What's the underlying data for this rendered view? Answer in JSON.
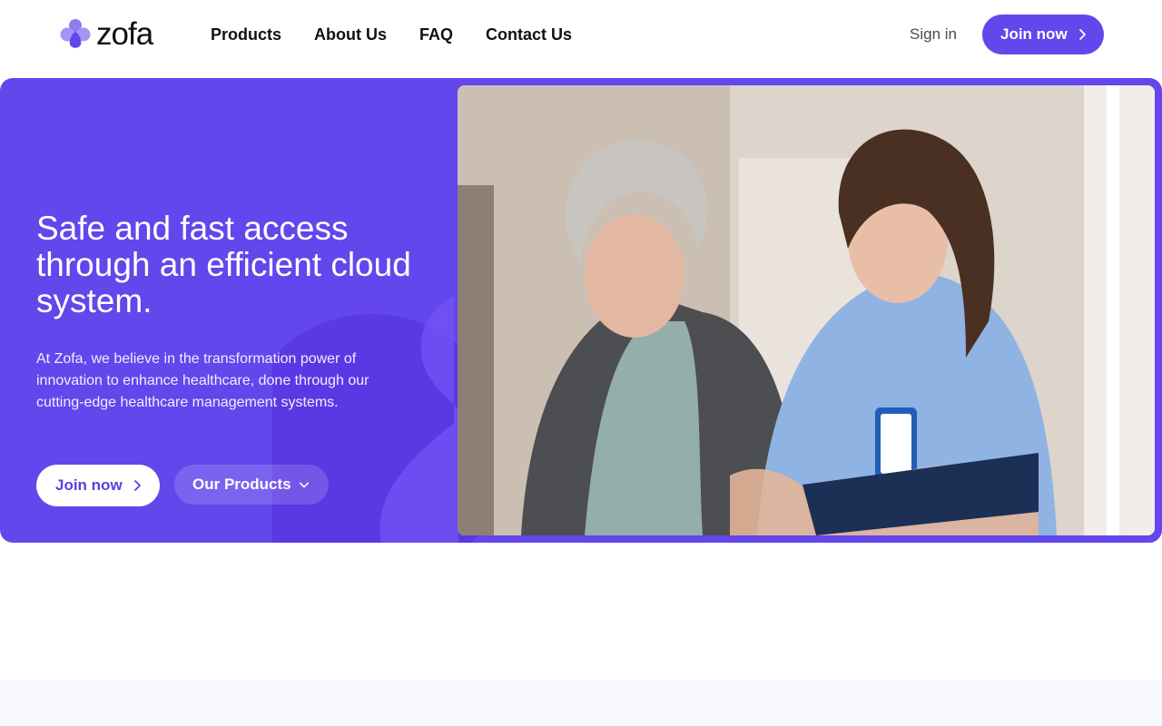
{
  "brand": {
    "name": "zofa",
    "color": "#6346ec"
  },
  "nav": {
    "items": [
      {
        "label": "Products"
      },
      {
        "label": "About Us"
      },
      {
        "label": "FAQ"
      },
      {
        "label": "Contact Us"
      }
    ],
    "sign_in": "Sign in",
    "join_now": "Join now"
  },
  "hero": {
    "title": "Safe and fast access through an efficient cloud system.",
    "description": "At Zofa, we believe in the transformation power of innovation to enhance healthcare, done through our cutting-edge healthcare management systems.",
    "primary_button": "Join now",
    "secondary_button": "Our Products",
    "background_color": "#6346ec"
  },
  "icons": {
    "logo": "zofa-logo-icon",
    "chevron_right": "chevron-right-icon",
    "chevron_down": "chevron-down-icon"
  }
}
